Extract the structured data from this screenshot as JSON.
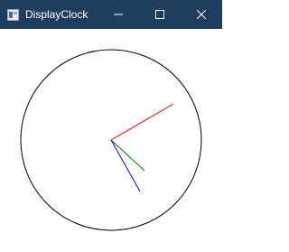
{
  "window": {
    "title": "DisplayClock",
    "titlebar_color": "#1f3d5f",
    "controls": {
      "minimize_icon": "minimize-icon",
      "maximize_icon": "maximize-icon",
      "close_icon": "close-icon"
    }
  },
  "clock": {
    "face_color": "#000000",
    "second_hand_color": "#ff0000",
    "minute_hand_color": "#008000",
    "hour_hand_color": "#0000ff"
  }
}
